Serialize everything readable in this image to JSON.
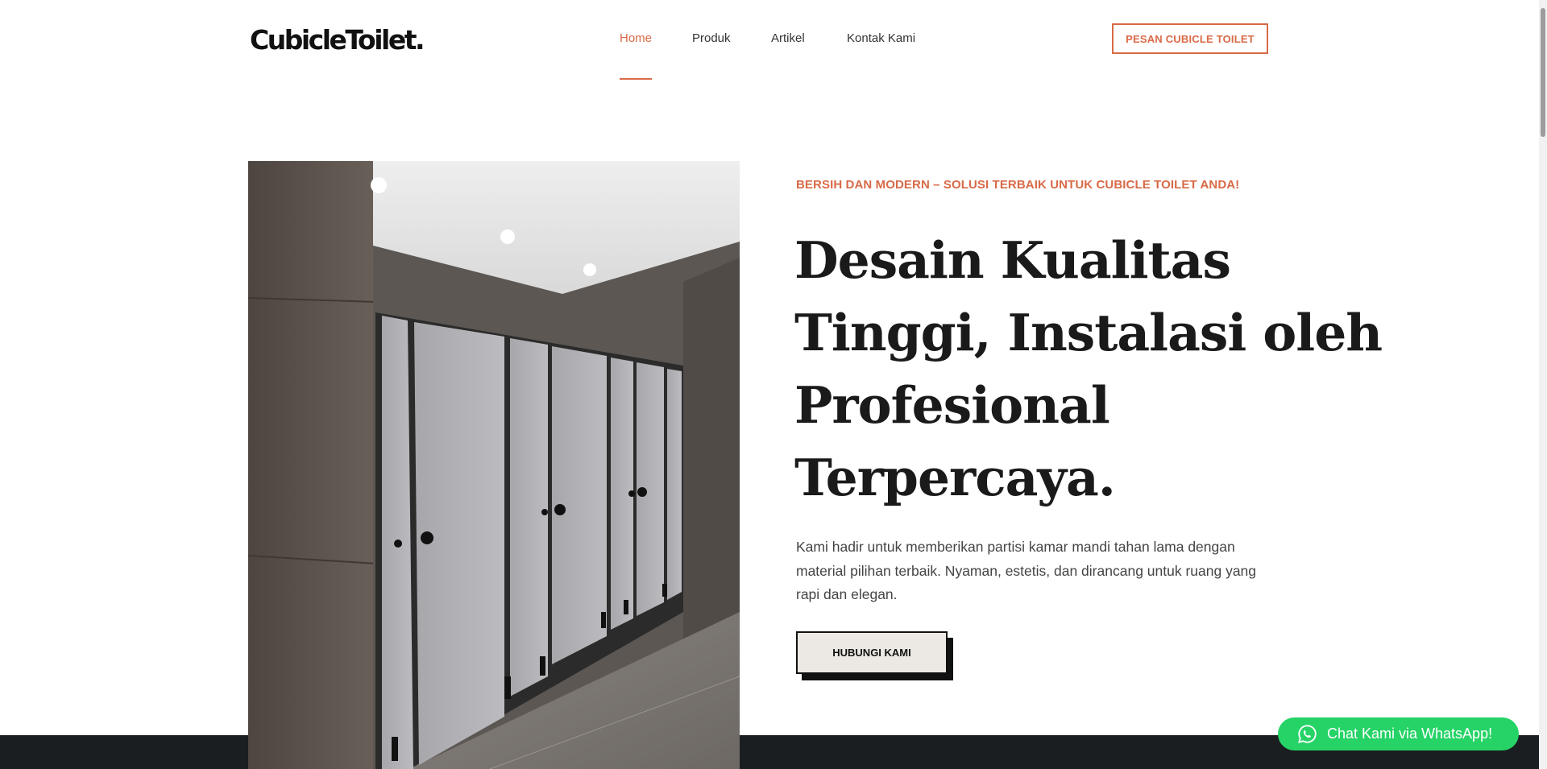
{
  "header": {
    "logo_text": "CubicleToilet.",
    "nav": [
      {
        "label": "Home",
        "active": true
      },
      {
        "label": "Produk",
        "active": false
      },
      {
        "label": "Artikel",
        "active": false
      },
      {
        "label": "Kontak Kami",
        "active": false
      }
    ],
    "cta_label": "PESAN CUBICLE TOILET"
  },
  "hero": {
    "eyebrow": "BERSIH DAN MODERN – SOLUSI TERBAIK UNTUK CUBICLE TOILET ANDA!",
    "headline_lines": [
      "Desain Kualitas",
      "Tinggi, Instalasi oleh",
      "Profesional",
      "Terpercaya."
    ],
    "body": "Kami hadir untuk memberikan partisi kamar mandi tahan lama dengan material pilihan terbaik. Nyaman, estetis, dan dirancang untuk ruang yang rapi dan elegan.",
    "cta_label": "HUBUNGI KAMI"
  },
  "whatsapp": {
    "label": "Chat Kami via WhatsApp!",
    "icon": "whatsapp-icon"
  },
  "colors": {
    "accent": "#d86a47",
    "dark": "#1b1e21",
    "whatsapp": "#25d366",
    "button_bg": "#ece9e4"
  }
}
